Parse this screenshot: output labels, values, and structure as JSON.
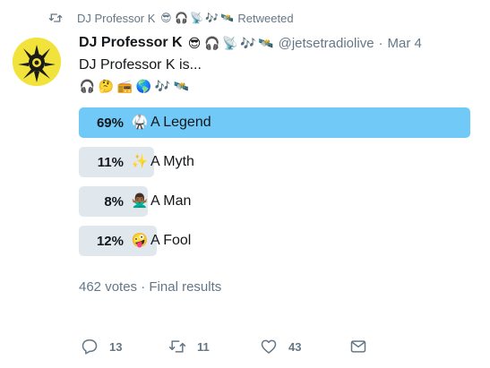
{
  "retweet": {
    "name": "DJ Professor K",
    "emojis": [
      "😎",
      "🎧",
      "📡",
      "🎶",
      "🛰️"
    ],
    "label": "Retweeted"
  },
  "tweet": {
    "author": "DJ Professor K",
    "emojis": [
      "😎",
      "🎧",
      "📡",
      "🎶",
      "🛰️"
    ],
    "handle": "@jetsetradiolive",
    "date": "Mar 4",
    "text": "DJ Professor K is...",
    "text_emojis": [
      "🎧",
      "🤔",
      "📻",
      "🌎",
      "🎶",
      "🛰️"
    ]
  },
  "poll": {
    "options": [
      {
        "percent": "69%",
        "fraction": 1.0,
        "emoji": "🥋",
        "label": "A Legend",
        "winner": true
      },
      {
        "percent": "11%",
        "fraction": 0.193,
        "emoji": "✨",
        "label": "A Myth",
        "winner": false
      },
      {
        "percent": "8%",
        "fraction": 0.176,
        "emoji": "🙅🏾‍♂️",
        "label": "A Man",
        "winner": false
      },
      {
        "percent": "12%",
        "fraction": 0.198,
        "emoji": "🤪",
        "label": "A Fool",
        "winner": false
      }
    ],
    "votes": "462 votes",
    "status": "Final results"
  },
  "actions": {
    "reply_count": "13",
    "retweet_count": "11",
    "like_count": "43"
  },
  "colors": {
    "winner_bar": "#71c9f8",
    "bar": "#e1e8ed",
    "secondary_text": "#657786"
  }
}
